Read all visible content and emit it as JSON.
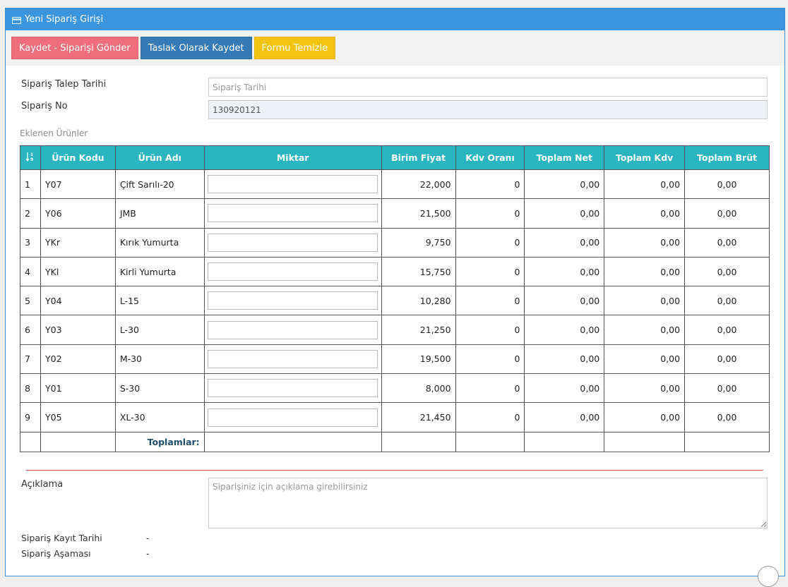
{
  "panel": {
    "title": "Yeni Sipariş Girişi"
  },
  "toolbar": {
    "submit_label": "Kaydet - Siparişi Gönder",
    "draft_label": "Taslak Olarak Kaydet",
    "clear_label": "Formu Temizle"
  },
  "form": {
    "date_label": "Sipariş Talep Tarihi",
    "date_placeholder": "Sipariş Tarihi",
    "order_no_label": "Sipariş No",
    "order_no_value": "130920121",
    "products_label": "Eklenen Ürünler"
  },
  "table": {
    "headers": {
      "code": "Ürün Kodu",
      "name": "Ürün Adı",
      "qty": "Miktar",
      "unit_price": "Birim Fiyat",
      "vat_rate": "Kdv Oranı",
      "net_total": "Toplam Net",
      "vat_total": "Toplam Kdv",
      "gross_total": "Toplam Brüt"
    },
    "rows": [
      {
        "no": "1",
        "code": "Y07",
        "name": "Çift Sarılı-20",
        "qty": "",
        "price": "22,000",
        "vat": "0",
        "net": "0,00",
        "kdv": "0,00",
        "gross": "0,00"
      },
      {
        "no": "2",
        "code": "Y06",
        "name": "JMB",
        "qty": "",
        "price": "21,500",
        "vat": "0",
        "net": "0,00",
        "kdv": "0,00",
        "gross": "0,00"
      },
      {
        "no": "3",
        "code": "YKr",
        "name": "Kırık Yumurta",
        "qty": "",
        "price": "9,750",
        "vat": "0",
        "net": "0,00",
        "kdv": "0,00",
        "gross": "0,00"
      },
      {
        "no": "4",
        "code": "YKl",
        "name": "Kirli Yumurta",
        "qty": "",
        "price": "15,750",
        "vat": "0",
        "net": "0,00",
        "kdv": "0,00",
        "gross": "0,00"
      },
      {
        "no": "5",
        "code": "Y04",
        "name": "L-15",
        "qty": "",
        "price": "10,280",
        "vat": "0",
        "net": "0,00",
        "kdv": "0,00",
        "gross": "0,00"
      },
      {
        "no": "6",
        "code": "Y03",
        "name": "L-30",
        "qty": "",
        "price": "21,250",
        "vat": "0",
        "net": "0,00",
        "kdv": "0,00",
        "gross": "0,00"
      },
      {
        "no": "7",
        "code": "Y02",
        "name": "M-30",
        "qty": "",
        "price": "19,500",
        "vat": "0",
        "net": "0,00",
        "kdv": "0,00",
        "gross": "0,00"
      },
      {
        "no": "8",
        "code": "Y01",
        "name": "S-30",
        "qty": "",
        "price": "8,000",
        "vat": "0",
        "net": "0,00",
        "kdv": "0,00",
        "gross": "0,00"
      },
      {
        "no": "9",
        "code": "Y05",
        "name": "XL-30",
        "qty": "",
        "price": "21,450",
        "vat": "0",
        "net": "0,00",
        "kdv": "0,00",
        "gross": "0,00"
      }
    ],
    "totals_label": "Toplamlar:"
  },
  "description": {
    "label": "Açıklama",
    "placeholder": "Siparişiniz için açıklama girebilirsiniz"
  },
  "meta": {
    "record_date_label": "Sipariş Kayıt Tarihi",
    "record_date_value": "-",
    "stage_label": "Sipariş Aşaması",
    "stage_value": "-"
  },
  "colors": {
    "header_bg": "#3a95dd",
    "table_header_bg": "#2bb5c1",
    "btn_submit": "#ee6f7b",
    "btn_draft": "#337ab7",
    "btn_clear": "#f4c311",
    "divider": "#d9534f"
  }
}
